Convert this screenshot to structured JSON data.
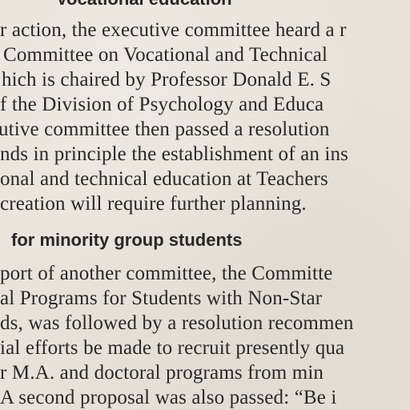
{
  "document": {
    "top_heading_fragment": "Vocational education",
    "section1_lines": [
      "r action, the executive committee heard a r",
      "Committee on Vocational and Technical",
      "hich is chaired by Professor Donald E. S",
      "f the Division of Psychology and Educa",
      "utive committee then passed a resolution",
      "nds in principle the establishment of an ins",
      "onal and technical education at Teachers",
      "creation will require further planning."
    ],
    "section2_heading": "for minority group students",
    "section2_lines": [
      "port of another committee, the Committe",
      "al Programs for Students with Non-Star",
      "ds, was followed by a resolution recommen",
      "ial efforts be made to recruit presently qua",
      "r M.A. and doctoral programs from min",
      "A second proposal was also passed: “Be i"
    ]
  }
}
